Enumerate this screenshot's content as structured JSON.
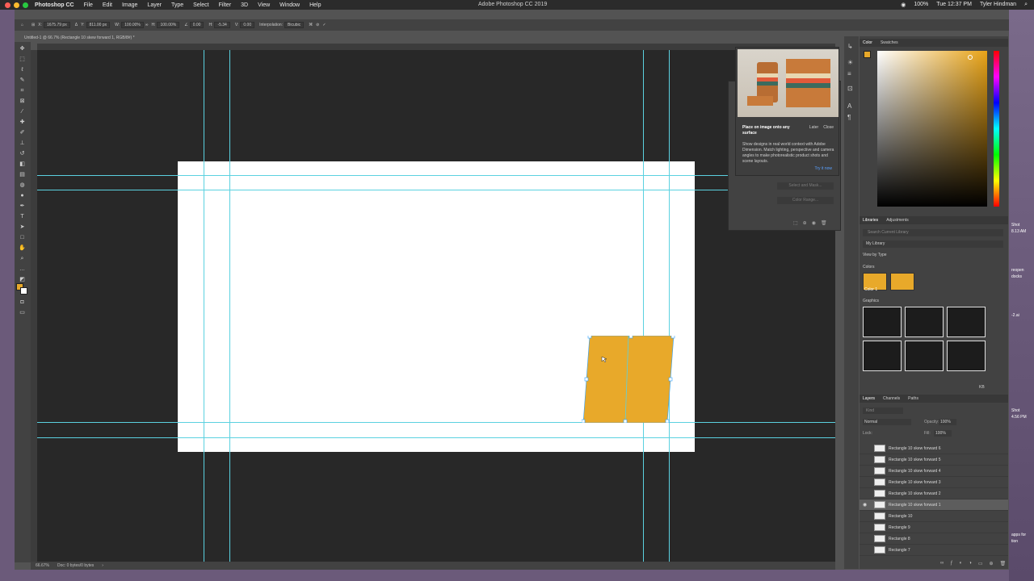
{
  "menubar": {
    "app_name": "Photoshop CC",
    "menus": [
      "File",
      "Edit",
      "Image",
      "Layer",
      "Type",
      "Select",
      "Filter",
      "3D",
      "View",
      "Window",
      "Help"
    ],
    "window_title": "Adobe Photoshop CC 2019",
    "battery": "100%",
    "clock": "Tue 12:37 PM",
    "user": "Tyler Hindman"
  },
  "optionsbar": {
    "x_label": "X:",
    "x_value": "1675.79 px",
    "y_label": "Y:",
    "y_value": "811.00 px",
    "w_label": "W:",
    "w_value": "100.00%",
    "h_label": "H:",
    "h_value": "100.00%",
    "angle_value": "0.00",
    "hskew_label": "H:",
    "hskew_value": "-5.34",
    "vskew_label": "V:",
    "vskew_value": "0.00",
    "interp_label": "Interpolation:",
    "interp_value": "Bicubic"
  },
  "document": {
    "tab_title": "Untitled-1 @ 66.7% (Rectangle 10 skew forward 1, RGB/8#) *",
    "zoom": "66.67%",
    "doc_info": "Doc: 0 bytes/0 bytes"
  },
  "shape": {
    "fill": "#e8a92a"
  },
  "promo": {
    "heading": "Place on image onto any surface",
    "later": "Later",
    "close": "Close",
    "body": "Show designs in real world context with Adobe Dimension. Match lighting, perspective and camera angles to make photorealistic product shots and scene layouts.",
    "cta": "Try it now"
  },
  "properties": {
    "select_mask": "Select and Mask...",
    "color_range": "Color Range..."
  },
  "color_panel": {
    "tabs": [
      "Color",
      "Swatches"
    ],
    "fg_color": "#e8a92a"
  },
  "libraries": {
    "tabs": [
      "Libraries",
      "Adjustments"
    ],
    "search_placeholder": "Search Current Library",
    "library_name": "My Library",
    "view_by": "View by Type",
    "colors_heading": "Colors",
    "color_label": "Color 1",
    "graphics_heading": "Graphics",
    "size_label": "KB"
  },
  "layers": {
    "tabs": [
      "Layers",
      "Channels",
      "Paths"
    ],
    "kind_placeholder": "Kind",
    "blend_mode": "Normal",
    "opacity_label": "Opacity:",
    "opacity_value": "100%",
    "lock_label": "Lock:",
    "fill_label": "Fill:",
    "fill_value": "100%",
    "items": [
      {
        "name": "Rectangle 10 skew forward 6",
        "selected": false
      },
      {
        "name": "Rectangle 10 skew forward 5",
        "selected": false
      },
      {
        "name": "Rectangle 10 skew forward 4",
        "selected": false
      },
      {
        "name": "Rectangle 10 skew forward 3",
        "selected": false
      },
      {
        "name": "Rectangle 10 skew forward 2",
        "selected": false
      },
      {
        "name": "Rectangle 10 skew forward 1",
        "selected": true
      },
      {
        "name": "Rectangle 10",
        "selected": false
      },
      {
        "name": "Rectangle 9",
        "selected": false
      },
      {
        "name": "Rectangle 8",
        "selected": false
      },
      {
        "name": "Rectangle 7",
        "selected": false
      }
    ]
  },
  "desktop": {
    "files": [
      "Shot",
      "8.13 AM",
      "reopen",
      "docks",
      "-2.ai",
      "Shot",
      "4.56 PM",
      "apps for",
      "tion"
    ]
  }
}
